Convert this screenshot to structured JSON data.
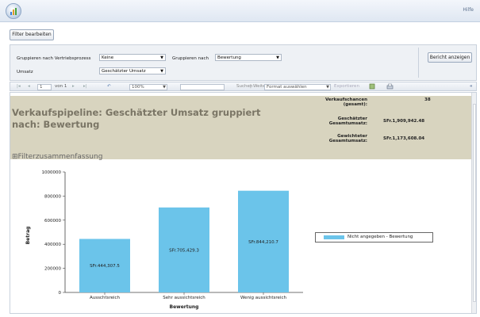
{
  "header": {
    "help": "Hilfe"
  },
  "filterbar": {
    "edit_filter_label": "Filter bearbeiten"
  },
  "params": {
    "group_by_process_label": "Gruppieren nach Vertriebsprozess",
    "group_by_process_value": "Keine",
    "group_by_label": "Gruppieren nach",
    "group_by_value": "Bewertung",
    "revenue_label": "Umsatz",
    "revenue_value": "Geschätzter Umsatz",
    "show_report_label": "Bericht anzeigen"
  },
  "toolbar": {
    "first": "|◂",
    "prev": "◂",
    "page": "1",
    "page_of": "von 1",
    "next": "▸",
    "last": "▸|",
    "back": "↶",
    "zoom": "100%",
    "search_placeholder": "",
    "search_label": "Suchen",
    "next_label": "Weiter",
    "format_label": "Format auswählen",
    "export_label": "Exportieren",
    "collapse": "«"
  },
  "report": {
    "title": "Verkaufspipeline: Geschätzter Umsatz gruppiert nach: Bewertung",
    "filter_summary": "⊞Filterzusammenfassung",
    "kpis": [
      {
        "label": "Verkaufschancen (gesamt):",
        "value": "38"
      },
      {
        "label": "Geschätzter Gesamtumsatz:",
        "value": "SFr.1,909,942.48"
      },
      {
        "label": "Gewichteter Gesamtumsatz:",
        "value": "SFr.1,173,608.04"
      }
    ]
  },
  "colors": {
    "bar": "#6bc4ea",
    "header_band": "#d8d4bf"
  },
  "chart_data": {
    "type": "bar",
    "categories": [
      "Ausschtsreich",
      "Sehr aussichtsreich",
      "Wenig aussichtsreich"
    ],
    "values": [
      444307.5,
      705429.3,
      844210.7
    ],
    "data_labels": [
      "SFr.444,307.5",
      "SFr.705,429.3",
      "SFr.844,210.7"
    ],
    "title": "",
    "xlabel": "Bewertung",
    "ylabel": "Betrag",
    "ylim": [
      0,
      1000000
    ],
    "yticks": [
      "0",
      "200000",
      "400000",
      "600000",
      "800000",
      "1000000"
    ],
    "legend": [
      "Nicht angegeben - Bewertung"
    ],
    "legend_position": "right",
    "grid": false
  }
}
